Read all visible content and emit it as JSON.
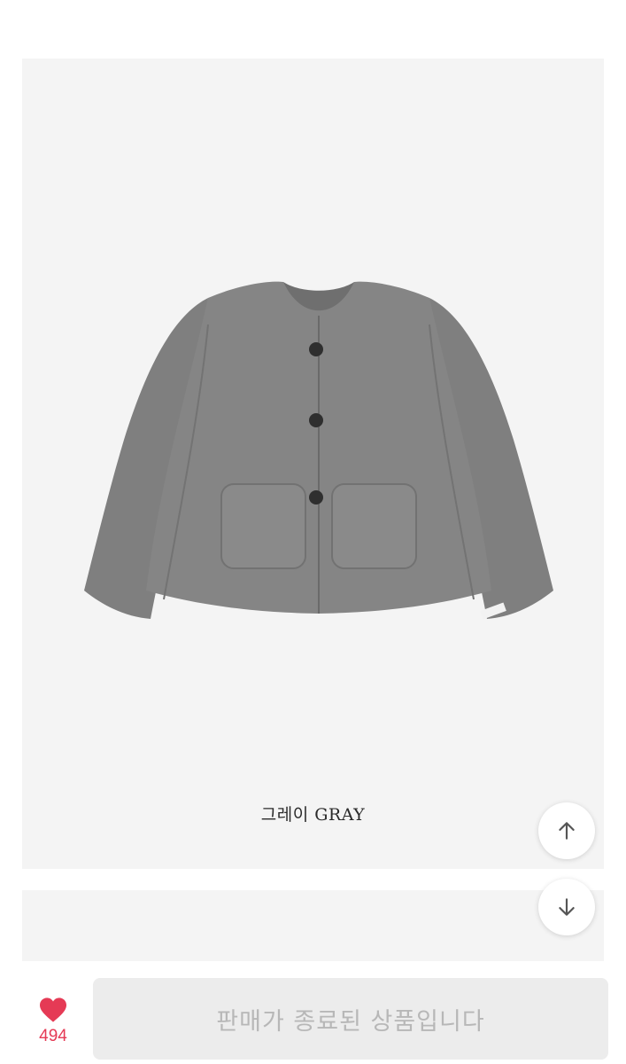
{
  "product": {
    "color_caption": "그레이 GRAY",
    "image_icon": "gray-wool-jacket-photo"
  },
  "actions": {
    "scroll_up_icon": "arrow-up-icon",
    "scroll_down_icon": "arrow-down-icon"
  },
  "footer": {
    "like_icon": "heart-icon",
    "like_count": "494",
    "sold_out_label": "판매가 종료된 상품입니다"
  },
  "colors": {
    "like_accent": "#e53a55",
    "card_background": "#f4f4f4",
    "button_disabled_bg": "#ececec",
    "button_disabled_text": "#b7b7b7"
  }
}
